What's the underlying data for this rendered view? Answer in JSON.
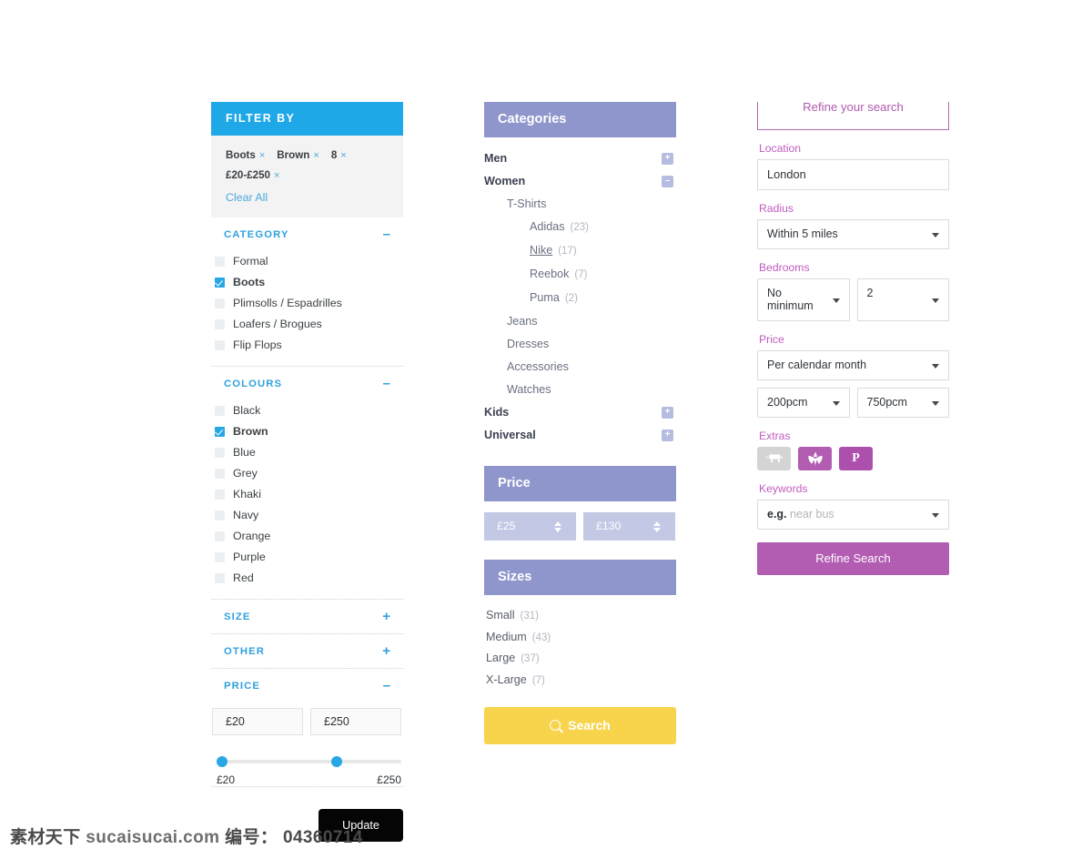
{
  "filter_panel": {
    "header": "FILTER BY",
    "tags_row1": [
      {
        "label": "Boots",
        "remove": "×"
      },
      {
        "label": "Brown",
        "remove": "×"
      },
      {
        "label": "8",
        "remove": "×"
      }
    ],
    "tags_row2": [
      {
        "label": "£20-£250",
        "remove": "×"
      }
    ],
    "clear_all": "Clear All",
    "sections": [
      {
        "title": "CATEGORY",
        "toggle": "–",
        "options": [
          {
            "label": "Formal",
            "checked": false
          },
          {
            "label": "Boots",
            "checked": true
          },
          {
            "label": "Plimsolls / Espadrilles",
            "checked": false
          },
          {
            "label": "Loafers / Brogues",
            "checked": false
          },
          {
            "label": "Flip Flops",
            "checked": false
          }
        ]
      },
      {
        "title": "COLOURS",
        "toggle": "–",
        "options": [
          {
            "label": "Black",
            "checked": false
          },
          {
            "label": "Brown",
            "checked": true
          },
          {
            "label": "Blue",
            "checked": false
          },
          {
            "label": "Grey",
            "checked": false
          },
          {
            "label": "Khaki",
            "checked": false
          },
          {
            "label": "Navy",
            "checked": false
          },
          {
            "label": "Orange",
            "checked": false
          },
          {
            "label": "Purple",
            "checked": false
          },
          {
            "label": "Red",
            "checked": false
          }
        ]
      },
      {
        "title": "SIZE",
        "toggle": "+",
        "options": []
      },
      {
        "title": "OTHER",
        "toggle": "+",
        "options": []
      }
    ],
    "price": {
      "title": "PRICE",
      "toggle": "–",
      "min_value": "£20",
      "max_value": "£250",
      "slider_min_label": "£20",
      "slider_max_label": "£250",
      "slider_left_pct": 0,
      "slider_right_pct": 65
    },
    "update_button": "Update",
    "accent_color": "#1fa8e8"
  },
  "categories_panel": {
    "header": "Categories",
    "items": [
      {
        "label": "Men",
        "level": 0,
        "toggle": "+",
        "count": "",
        "underline": false
      },
      {
        "label": "Women",
        "level": 0,
        "toggle": "–",
        "count": "",
        "underline": false
      },
      {
        "label": "T-Shirts",
        "level": 1,
        "toggle": "",
        "count": "",
        "underline": false
      },
      {
        "label": "Adidas",
        "level": 2,
        "toggle": "",
        "count": "(23)",
        "underline": false
      },
      {
        "label": "Nike",
        "level": 2,
        "toggle": "",
        "count": "(17)",
        "underline": true
      },
      {
        "label": "Reebok",
        "level": 2,
        "toggle": "",
        "count": "(7)",
        "underline": false
      },
      {
        "label": "Puma",
        "level": 2,
        "toggle": "",
        "count": "(2)",
        "underline": false
      },
      {
        "label": "Jeans",
        "level": 1,
        "toggle": "",
        "count": "",
        "underline": false
      },
      {
        "label": "Dresses",
        "level": 1,
        "toggle": "",
        "count": "",
        "underline": false
      },
      {
        "label": "Accessories",
        "level": 1,
        "toggle": "",
        "count": "",
        "underline": false
      },
      {
        "label": "Watches",
        "level": 1,
        "toggle": "",
        "count": "",
        "underline": false
      },
      {
        "label": "Kids",
        "level": 0,
        "toggle": "+",
        "count": "",
        "underline": false
      },
      {
        "label": "Universal",
        "level": 0,
        "toggle": "+",
        "count": "",
        "underline": false
      }
    ],
    "price": {
      "header": "Price",
      "min_value": "£25",
      "max_value": "£130"
    },
    "sizes": {
      "header": "Sizes",
      "items": [
        {
          "label": "Small",
          "count": "(31)"
        },
        {
          "label": "Medium",
          "count": "(43)"
        },
        {
          "label": "Large",
          "count": "(37)"
        },
        {
          "label": "X-Large",
          "count": "(7)"
        }
      ]
    },
    "search_button": "Search",
    "header_color": "#8f96cc",
    "search_color": "#f8d44d"
  },
  "refine_panel": {
    "legend": "Refine your search",
    "location": {
      "label": "Location",
      "value": "London"
    },
    "radius": {
      "label": "Radius",
      "value": "Within 5 miles"
    },
    "bedrooms": {
      "label": "Bedrooms",
      "min_value": "No minimum",
      "max_value": "2"
    },
    "price": {
      "label": "Price",
      "period_value": "Per calendar month",
      "min_value": "200pcm",
      "max_value": "750pcm"
    },
    "extras": {
      "label": "Extras",
      "buttons": [
        {
          "icon": "dog-icon",
          "active": false,
          "text": ""
        },
        {
          "icon": "flower-icon",
          "active": true,
          "text": ""
        },
        {
          "icon": "parking-icon",
          "active": true,
          "text": "P"
        }
      ]
    },
    "keywords": {
      "label": "Keywords",
      "placeholder_prefix": "e.g.",
      "placeholder_rest": "near bus"
    },
    "submit_button": "Refine Search",
    "accent_color": "#b25cb2"
  },
  "watermark": {
    "brand": "素材天下",
    "site": "sucaisucai.com",
    "id_label": "编号：",
    "id_value": "04360714"
  }
}
